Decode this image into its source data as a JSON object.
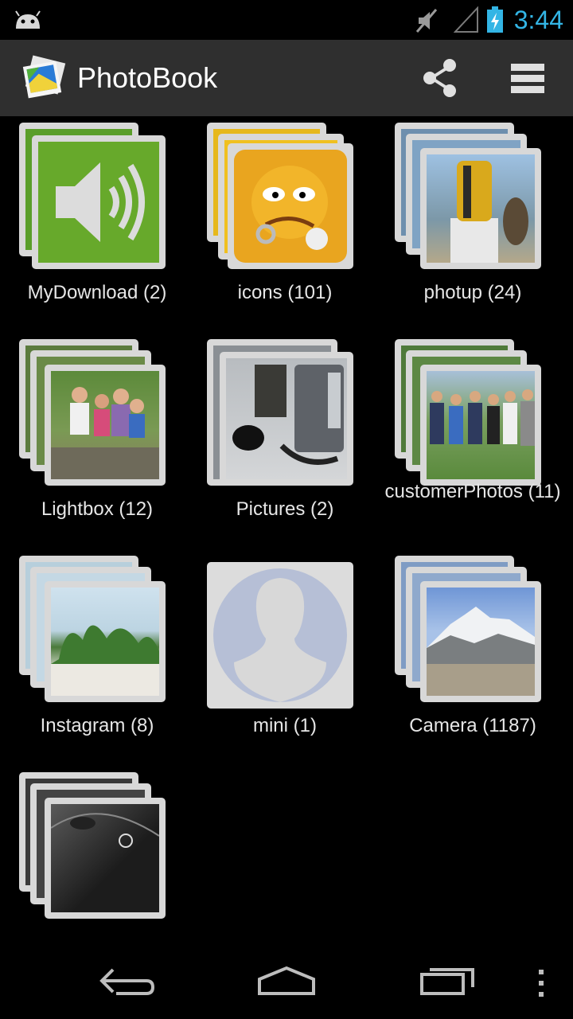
{
  "status_bar": {
    "time": "3:44",
    "icons": [
      "android-icon",
      "mute-icon",
      "signal-icon",
      "battery-charging-icon"
    ]
  },
  "action_bar": {
    "title": "PhotoBook",
    "actions": [
      "share-icon",
      "menu-icon"
    ]
  },
  "albums": [
    {
      "label": "MyDownload (2)"
    },
    {
      "label": "icons (101)"
    },
    {
      "label": "photup (24)"
    },
    {
      "label": "Lightbox (12)"
    },
    {
      "label": "Pictures (2)"
    },
    {
      "label": "customerPhotos (11)"
    },
    {
      "label": "Instagram (8)"
    },
    {
      "label": "mini (1)"
    },
    {
      "label": "Camera (1187)"
    },
    {
      "label": ""
    }
  ],
  "nav_bar": {
    "buttons": [
      "back-icon",
      "home-icon",
      "recent-apps-icon",
      "overflow-icon"
    ]
  },
  "colors": {
    "accent": "#33b5e5",
    "action_bar_bg": "#2f2f2f",
    "card": "#d8d8d8"
  }
}
